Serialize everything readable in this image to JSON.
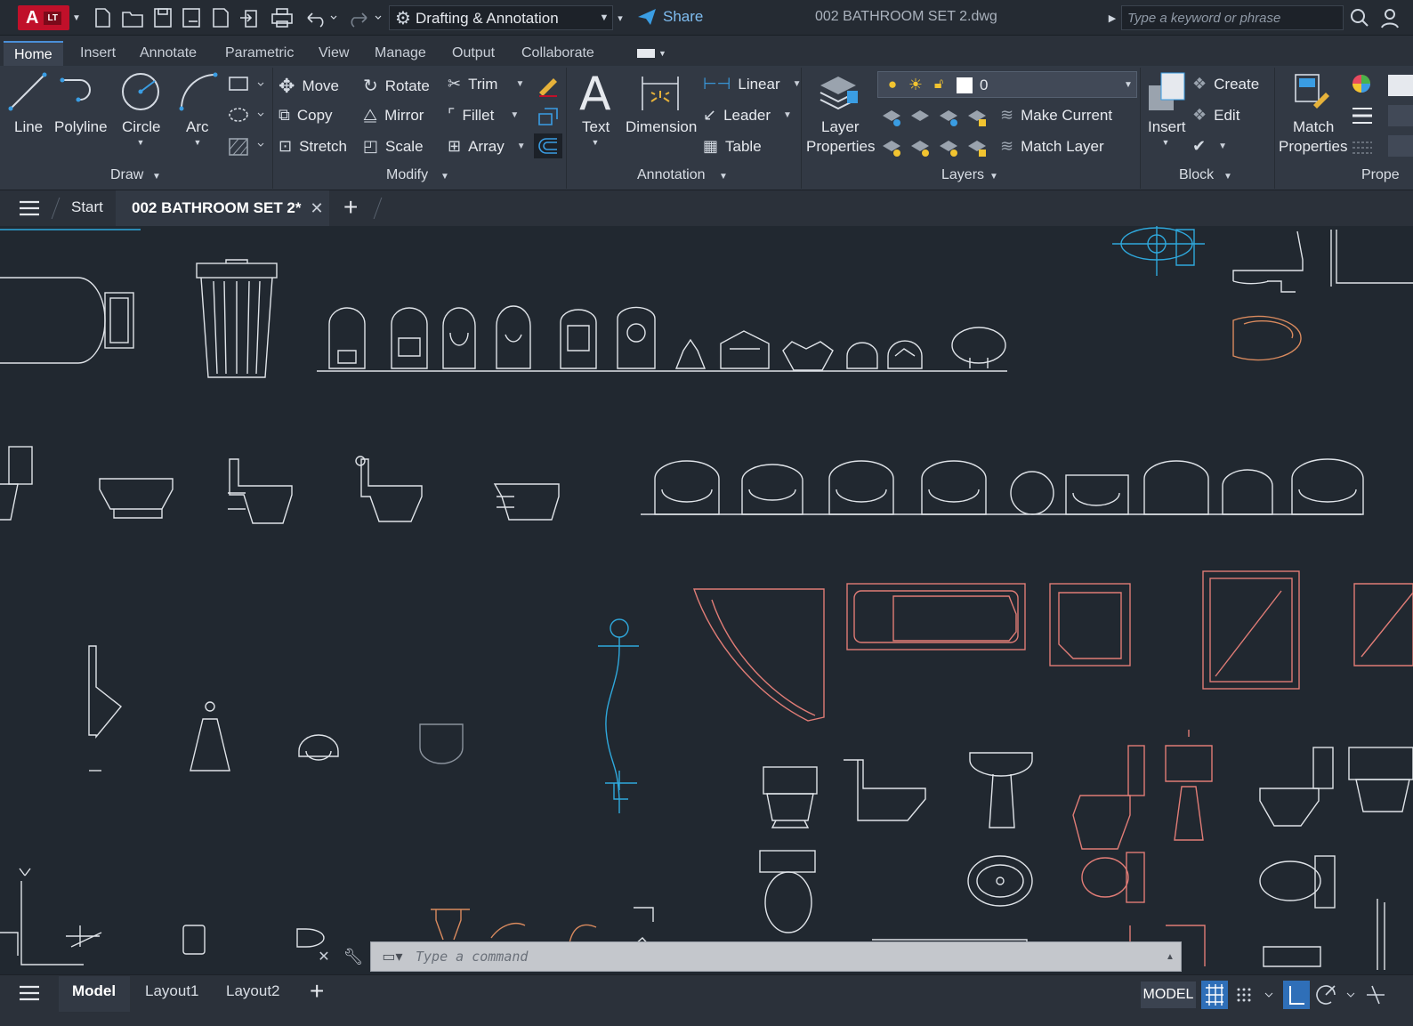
{
  "app": {
    "logo_letter": "A",
    "logo_badge": "LT",
    "file_title": "002 BATHROOM SET 2.dwg"
  },
  "quick_access": {
    "workspace": "Drafting & Annotation",
    "share_label": "Share"
  },
  "search": {
    "placeholder": "Type a keyword or phrase"
  },
  "ribbon_tabs": [
    "Home",
    "Insert",
    "Annotate",
    "Parametric",
    "View",
    "Manage",
    "Output",
    "Collaborate"
  ],
  "draw": {
    "line": "Line",
    "polyline": "Polyline",
    "circle": "Circle",
    "arc": "Arc",
    "panel": "Draw"
  },
  "modify": {
    "move": "Move",
    "rotate": "Rotate",
    "trim": "Trim",
    "copy": "Copy",
    "mirror": "Mirror",
    "fillet": "Fillet",
    "stretch": "Stretch",
    "scale": "Scale",
    "array": "Array",
    "panel": "Modify"
  },
  "annotation": {
    "text": "Text",
    "dimension": "Dimension",
    "linear": "Linear",
    "leader": "Leader",
    "table": "Table",
    "panel": "Annotation"
  },
  "layers": {
    "layer_properties_1": "Layer",
    "layer_properties_2": "Properties",
    "current_layer": "0",
    "make_current": "Make Current",
    "match_layer": "Match Layer",
    "panel": "Layers"
  },
  "block": {
    "insert": "Insert",
    "create": "Create",
    "edit": "Edit",
    "panel": "Block"
  },
  "properties": {
    "match_1": "Match",
    "match_2": "Properties",
    "panel": "Prope"
  },
  "doc_tabs": {
    "start": "Start",
    "current": "002 BATHROOM SET 2*"
  },
  "command": {
    "placeholder": "Type  a  command"
  },
  "layout_tabs": {
    "model": "Model",
    "layout1": "Layout1",
    "layout2": "Layout2"
  },
  "status": {
    "space": "MODEL"
  },
  "colors": {
    "accent": "#4a8fd8",
    "canvas": "#212830",
    "cad_white": "#dfe3e8",
    "cad_red": "#e07c76",
    "cad_cyan": "#2fa8dc",
    "cad_orange": "#d98a5e"
  }
}
